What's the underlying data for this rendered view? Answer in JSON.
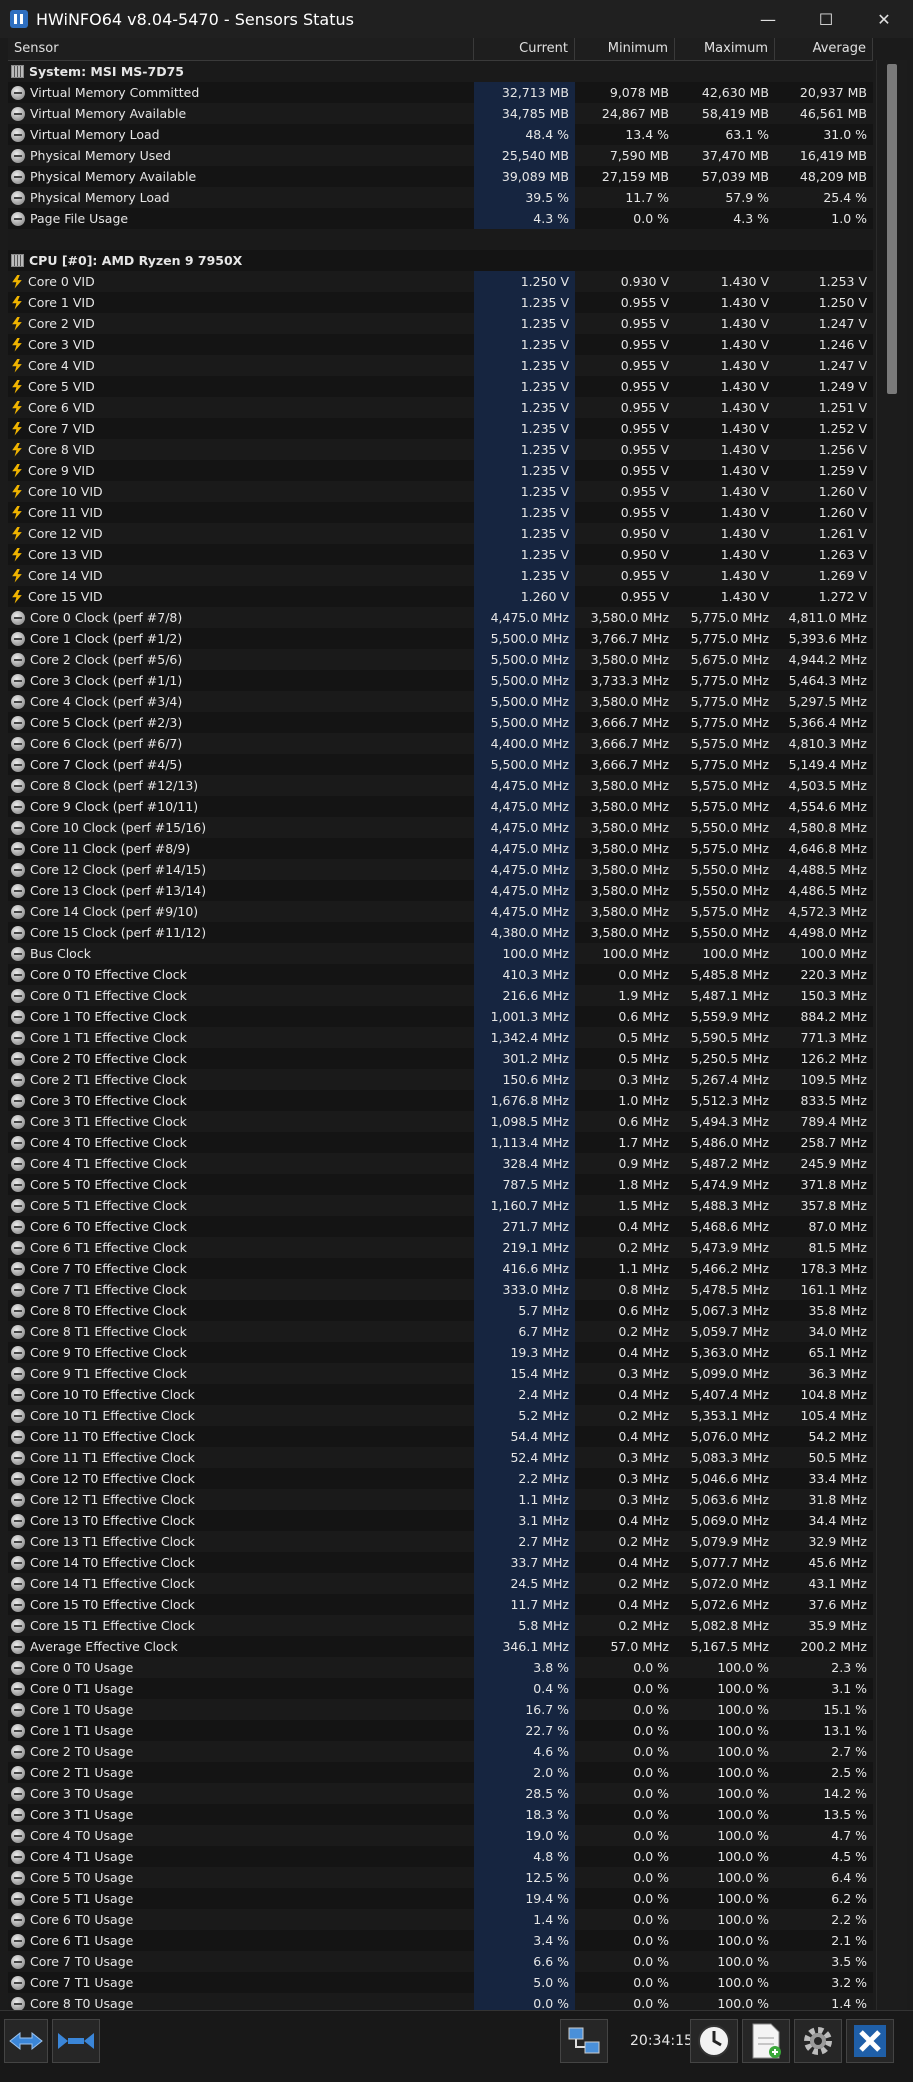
{
  "window": {
    "title": "HWiNFO64 v8.04-5470 - Sensors Status",
    "minimize": "—",
    "maximize": "☐",
    "close": "✕"
  },
  "columns": [
    "Sensor",
    "Current",
    "Minimum",
    "Maximum",
    "Average"
  ],
  "rows": [
    {
      "type": "group",
      "name": "System: MSI MS-7D75"
    },
    {
      "icon": "circle",
      "name": "Virtual Memory Committed",
      "cur": "32,713 MB",
      "min": "9,078 MB",
      "max": "42,630 MB",
      "avg": "20,937 MB"
    },
    {
      "icon": "circle",
      "name": "Virtual Memory Available",
      "cur": "34,785 MB",
      "min": "24,867 MB",
      "max": "58,419 MB",
      "avg": "46,561 MB"
    },
    {
      "icon": "circle",
      "name": "Virtual Memory Load",
      "cur": "48.4 %",
      "min": "13.4 %",
      "max": "63.1 %",
      "avg": "31.0 %"
    },
    {
      "icon": "circle",
      "name": "Physical Memory Used",
      "cur": "25,540 MB",
      "min": "7,590 MB",
      "max": "37,470 MB",
      "avg": "16,419 MB"
    },
    {
      "icon": "circle",
      "name": "Physical Memory Available",
      "cur": "39,089 MB",
      "min": "27,159 MB",
      "max": "57,039 MB",
      "avg": "48,209 MB"
    },
    {
      "icon": "circle",
      "name": "Physical Memory Load",
      "cur": "39.5 %",
      "min": "11.7 %",
      "max": "57.9 %",
      "avg": "25.4 %"
    },
    {
      "icon": "circle",
      "name": "Page File Usage",
      "cur": "4.3 %",
      "min": "0.0 %",
      "max": "4.3 %",
      "avg": "1.0 %"
    },
    {
      "type": "blank",
      "name": ""
    },
    {
      "type": "group",
      "name": "CPU [#0]: AMD Ryzen 9 7950X"
    },
    {
      "icon": "bolt",
      "name": "Core 0 VID",
      "cur": "1.250 V",
      "min": "0.930 V",
      "max": "1.430 V",
      "avg": "1.253 V"
    },
    {
      "icon": "bolt",
      "name": "Core 1 VID",
      "cur": "1.235 V",
      "min": "0.955 V",
      "max": "1.430 V",
      "avg": "1.250 V"
    },
    {
      "icon": "bolt",
      "name": "Core 2 VID",
      "cur": "1.235 V",
      "min": "0.955 V",
      "max": "1.430 V",
      "avg": "1.247 V"
    },
    {
      "icon": "bolt",
      "name": "Core 3 VID",
      "cur": "1.235 V",
      "min": "0.955 V",
      "max": "1.430 V",
      "avg": "1.246 V"
    },
    {
      "icon": "bolt",
      "name": "Core 4 VID",
      "cur": "1.235 V",
      "min": "0.955 V",
      "max": "1.430 V",
      "avg": "1.247 V"
    },
    {
      "icon": "bolt",
      "name": "Core 5 VID",
      "cur": "1.235 V",
      "min": "0.955 V",
      "max": "1.430 V",
      "avg": "1.249 V"
    },
    {
      "icon": "bolt",
      "name": "Core 6 VID",
      "cur": "1.235 V",
      "min": "0.955 V",
      "max": "1.430 V",
      "avg": "1.251 V"
    },
    {
      "icon": "bolt",
      "name": "Core 7 VID",
      "cur": "1.235 V",
      "min": "0.955 V",
      "max": "1.430 V",
      "avg": "1.252 V"
    },
    {
      "icon": "bolt",
      "name": "Core 8 VID",
      "cur": "1.235 V",
      "min": "0.955 V",
      "max": "1.430 V",
      "avg": "1.256 V"
    },
    {
      "icon": "bolt",
      "name": "Core 9 VID",
      "cur": "1.235 V",
      "min": "0.955 V",
      "max": "1.430 V",
      "avg": "1.259 V"
    },
    {
      "icon": "bolt",
      "name": "Core 10 VID",
      "cur": "1.235 V",
      "min": "0.955 V",
      "max": "1.430 V",
      "avg": "1.260 V"
    },
    {
      "icon": "bolt",
      "name": "Core 11 VID",
      "cur": "1.235 V",
      "min": "0.955 V",
      "max": "1.430 V",
      "avg": "1.260 V"
    },
    {
      "icon": "bolt",
      "name": "Core 12 VID",
      "cur": "1.235 V",
      "min": "0.950 V",
      "max": "1.430 V",
      "avg": "1.261 V"
    },
    {
      "icon": "bolt",
      "name": "Core 13 VID",
      "cur": "1.235 V",
      "min": "0.950 V",
      "max": "1.430 V",
      "avg": "1.263 V"
    },
    {
      "icon": "bolt",
      "name": "Core 14 VID",
      "cur": "1.235 V",
      "min": "0.955 V",
      "max": "1.430 V",
      "avg": "1.269 V"
    },
    {
      "icon": "bolt",
      "name": "Core 15 VID",
      "cur": "1.260 V",
      "min": "0.955 V",
      "max": "1.430 V",
      "avg": "1.272 V"
    },
    {
      "icon": "circle",
      "name": "Core 0 Clock (perf #7/8)",
      "cur": "4,475.0 MHz",
      "min": "3,580.0 MHz",
      "max": "5,775.0 MHz",
      "avg": "4,811.0 MHz"
    },
    {
      "icon": "circle",
      "name": "Core 1 Clock (perf #1/2)",
      "cur": "5,500.0 MHz",
      "min": "3,766.7 MHz",
      "max": "5,775.0 MHz",
      "avg": "5,393.6 MHz"
    },
    {
      "icon": "circle",
      "name": "Core 2 Clock (perf #5/6)",
      "cur": "5,500.0 MHz",
      "min": "3,580.0 MHz",
      "max": "5,675.0 MHz",
      "avg": "4,944.2 MHz"
    },
    {
      "icon": "circle",
      "name": "Core 3 Clock (perf #1/1)",
      "cur": "5,500.0 MHz",
      "min": "3,733.3 MHz",
      "max": "5,775.0 MHz",
      "avg": "5,464.3 MHz"
    },
    {
      "icon": "circle",
      "name": "Core 4 Clock (perf #3/4)",
      "cur": "5,500.0 MHz",
      "min": "3,580.0 MHz",
      "max": "5,775.0 MHz",
      "avg": "5,297.5 MHz"
    },
    {
      "icon": "circle",
      "name": "Core 5 Clock (perf #2/3)",
      "cur": "5,500.0 MHz",
      "min": "3,666.7 MHz",
      "max": "5,775.0 MHz",
      "avg": "5,366.4 MHz"
    },
    {
      "icon": "circle",
      "name": "Core 6 Clock (perf #6/7)",
      "cur": "4,400.0 MHz",
      "min": "3,666.7 MHz",
      "max": "5,575.0 MHz",
      "avg": "4,810.3 MHz"
    },
    {
      "icon": "circle",
      "name": "Core 7 Clock (perf #4/5)",
      "cur": "5,500.0 MHz",
      "min": "3,666.7 MHz",
      "max": "5,775.0 MHz",
      "avg": "5,149.4 MHz"
    },
    {
      "icon": "circle",
      "name": "Core 8 Clock (perf #12/13)",
      "cur": "4,475.0 MHz",
      "min": "3,580.0 MHz",
      "max": "5,575.0 MHz",
      "avg": "4,503.5 MHz"
    },
    {
      "icon": "circle",
      "name": "Core 9 Clock (perf #10/11)",
      "cur": "4,475.0 MHz",
      "min": "3,580.0 MHz",
      "max": "5,575.0 MHz",
      "avg": "4,554.6 MHz"
    },
    {
      "icon": "circle",
      "name": "Core 10 Clock (perf #15/16)",
      "cur": "4,475.0 MHz",
      "min": "3,580.0 MHz",
      "max": "5,550.0 MHz",
      "avg": "4,580.8 MHz"
    },
    {
      "icon": "circle",
      "name": "Core 11 Clock (perf #8/9)",
      "cur": "4,475.0 MHz",
      "min": "3,580.0 MHz",
      "max": "5,575.0 MHz",
      "avg": "4,646.8 MHz"
    },
    {
      "icon": "circle",
      "name": "Core 12 Clock (perf #14/15)",
      "cur": "4,475.0 MHz",
      "min": "3,580.0 MHz",
      "max": "5,550.0 MHz",
      "avg": "4,488.5 MHz"
    },
    {
      "icon": "circle",
      "name": "Core 13 Clock (perf #13/14)",
      "cur": "4,475.0 MHz",
      "min": "3,580.0 MHz",
      "max": "5,550.0 MHz",
      "avg": "4,486.5 MHz"
    },
    {
      "icon": "circle",
      "name": "Core 14 Clock (perf #9/10)",
      "cur": "4,475.0 MHz",
      "min": "3,580.0 MHz",
      "max": "5,575.0 MHz",
      "avg": "4,572.3 MHz"
    },
    {
      "icon": "circle",
      "name": "Core 15 Clock (perf #11/12)",
      "cur": "4,380.0 MHz",
      "min": "3,580.0 MHz",
      "max": "5,550.0 MHz",
      "avg": "4,498.0 MHz"
    },
    {
      "icon": "circle",
      "name": "Bus Clock",
      "cur": "100.0 MHz",
      "min": "100.0 MHz",
      "max": "100.0 MHz",
      "avg": "100.0 MHz"
    },
    {
      "icon": "circle",
      "name": "Core 0 T0 Effective Clock",
      "cur": "410.3 MHz",
      "min": "0.0 MHz",
      "max": "5,485.8 MHz",
      "avg": "220.3 MHz"
    },
    {
      "icon": "circle",
      "name": "Core 0 T1 Effective Clock",
      "cur": "216.6 MHz",
      "min": "1.9 MHz",
      "max": "5,487.1 MHz",
      "avg": "150.3 MHz"
    },
    {
      "icon": "circle",
      "name": "Core 1 T0 Effective Clock",
      "cur": "1,001.3 MHz",
      "min": "0.6 MHz",
      "max": "5,559.9 MHz",
      "avg": "884.2 MHz"
    },
    {
      "icon": "circle",
      "name": "Core 1 T1 Effective Clock",
      "cur": "1,342.4 MHz",
      "min": "0.5 MHz",
      "max": "5,590.5 MHz",
      "avg": "771.3 MHz"
    },
    {
      "icon": "circle",
      "name": "Core 2 T0 Effective Clock",
      "cur": "301.2 MHz",
      "min": "0.5 MHz",
      "max": "5,250.5 MHz",
      "avg": "126.2 MHz"
    },
    {
      "icon": "circle",
      "name": "Core 2 T1 Effective Clock",
      "cur": "150.6 MHz",
      "min": "0.3 MHz",
      "max": "5,267.4 MHz",
      "avg": "109.5 MHz"
    },
    {
      "icon": "circle",
      "name": "Core 3 T0 Effective Clock",
      "cur": "1,676.8 MHz",
      "min": "1.0 MHz",
      "max": "5,512.3 MHz",
      "avg": "833.5 MHz"
    },
    {
      "icon": "circle",
      "name": "Core 3 T1 Effective Clock",
      "cur": "1,098.5 MHz",
      "min": "0.6 MHz",
      "max": "5,494.3 MHz",
      "avg": "789.4 MHz"
    },
    {
      "icon": "circle",
      "name": "Core 4 T0 Effective Clock",
      "cur": "1,113.4 MHz",
      "min": "1.7 MHz",
      "max": "5,486.0 MHz",
      "avg": "258.7 MHz"
    },
    {
      "icon": "circle",
      "name": "Core 4 T1 Effective Clock",
      "cur": "328.4 MHz",
      "min": "0.9 MHz",
      "max": "5,487.2 MHz",
      "avg": "245.9 MHz"
    },
    {
      "icon": "circle",
      "name": "Core 5 T0 Effective Clock",
      "cur": "787.5 MHz",
      "min": "1.8 MHz",
      "max": "5,474.9 MHz",
      "avg": "371.8 MHz"
    },
    {
      "icon": "circle",
      "name": "Core 5 T1 Effective Clock",
      "cur": "1,160.7 MHz",
      "min": "1.5 MHz",
      "max": "5,488.3 MHz",
      "avg": "357.8 MHz"
    },
    {
      "icon": "circle",
      "name": "Core 6 T0 Effective Clock",
      "cur": "271.7 MHz",
      "min": "0.4 MHz",
      "max": "5,468.6 MHz",
      "avg": "87.0 MHz"
    },
    {
      "icon": "circle",
      "name": "Core 6 T1 Effective Clock",
      "cur": "219.1 MHz",
      "min": "0.2 MHz",
      "max": "5,473.9 MHz",
      "avg": "81.5 MHz"
    },
    {
      "icon": "circle",
      "name": "Core 7 T0 Effective Clock",
      "cur": "416.6 MHz",
      "min": "1.1 MHz",
      "max": "5,466.2 MHz",
      "avg": "178.3 MHz"
    },
    {
      "icon": "circle",
      "name": "Core 7 T1 Effective Clock",
      "cur": "333.0 MHz",
      "min": "0.8 MHz",
      "max": "5,478.5 MHz",
      "avg": "161.1 MHz"
    },
    {
      "icon": "circle",
      "name": "Core 8 T0 Effective Clock",
      "cur": "5.7 MHz",
      "min": "0.6 MHz",
      "max": "5,067.3 MHz",
      "avg": "35.8 MHz"
    },
    {
      "icon": "circle",
      "name": "Core 8 T1 Effective Clock",
      "cur": "6.7 MHz",
      "min": "0.2 MHz",
      "max": "5,059.7 MHz",
      "avg": "34.0 MHz"
    },
    {
      "icon": "circle",
      "name": "Core 9 T0 Effective Clock",
      "cur": "19.3 MHz",
      "min": "0.4 MHz",
      "max": "5,363.0 MHz",
      "avg": "65.1 MHz"
    },
    {
      "icon": "circle",
      "name": "Core 9 T1 Effective Clock",
      "cur": "15.4 MHz",
      "min": "0.3 MHz",
      "max": "5,099.0 MHz",
      "avg": "36.3 MHz"
    },
    {
      "icon": "circle",
      "name": "Core 10 T0 Effective Clock",
      "cur": "2.4 MHz",
      "min": "0.4 MHz",
      "max": "5,407.4 MHz",
      "avg": "104.8 MHz"
    },
    {
      "icon": "circle",
      "name": "Core 10 T1 Effective Clock",
      "cur": "5.2 MHz",
      "min": "0.2 MHz",
      "max": "5,353.1 MHz",
      "avg": "105.4 MHz"
    },
    {
      "icon": "circle",
      "name": "Core 11 T0 Effective Clock",
      "cur": "54.4 MHz",
      "min": "0.4 MHz",
      "max": "5,076.0 MHz",
      "avg": "54.2 MHz"
    },
    {
      "icon": "circle",
      "name": "Core 11 T1 Effective Clock",
      "cur": "52.4 MHz",
      "min": "0.3 MHz",
      "max": "5,083.3 MHz",
      "avg": "50.5 MHz"
    },
    {
      "icon": "circle",
      "name": "Core 12 T0 Effective Clock",
      "cur": "2.2 MHz",
      "min": "0.3 MHz",
      "max": "5,046.6 MHz",
      "avg": "33.4 MHz"
    },
    {
      "icon": "circle",
      "name": "Core 12 T1 Effective Clock",
      "cur": "1.1 MHz",
      "min": "0.3 MHz",
      "max": "5,063.6 MHz",
      "avg": "31.8 MHz"
    },
    {
      "icon": "circle",
      "name": "Core 13 T0 Effective Clock",
      "cur": "3.1 MHz",
      "min": "0.4 MHz",
      "max": "5,069.0 MHz",
      "avg": "34.4 MHz"
    },
    {
      "icon": "circle",
      "name": "Core 13 T1 Effective Clock",
      "cur": "2.7 MHz",
      "min": "0.2 MHz",
      "max": "5,079.9 MHz",
      "avg": "32.9 MHz"
    },
    {
      "icon": "circle",
      "name": "Core 14 T0 Effective Clock",
      "cur": "33.7 MHz",
      "min": "0.4 MHz",
      "max": "5,077.7 MHz",
      "avg": "45.6 MHz"
    },
    {
      "icon": "circle",
      "name": "Core 14 T1 Effective Clock",
      "cur": "24.5 MHz",
      "min": "0.2 MHz",
      "max": "5,072.0 MHz",
      "avg": "43.1 MHz"
    },
    {
      "icon": "circle",
      "name": "Core 15 T0 Effective Clock",
      "cur": "11.7 MHz",
      "min": "0.4 MHz",
      "max": "5,072.6 MHz",
      "avg": "37.6 MHz"
    },
    {
      "icon": "circle",
      "name": "Core 15 T1 Effective Clock",
      "cur": "5.8 MHz",
      "min": "0.2 MHz",
      "max": "5,082.8 MHz",
      "avg": "35.9 MHz"
    },
    {
      "icon": "circle",
      "name": "Average Effective Clock",
      "cur": "346.1 MHz",
      "min": "57.0 MHz",
      "max": "5,167.5 MHz",
      "avg": "200.2 MHz"
    },
    {
      "icon": "circle",
      "name": "Core 0 T0 Usage",
      "cur": "3.8 %",
      "min": "0.0 %",
      "max": "100.0 %",
      "avg": "2.3 %"
    },
    {
      "icon": "circle",
      "name": "Core 0 T1 Usage",
      "cur": "0.4 %",
      "min": "0.0 %",
      "max": "100.0 %",
      "avg": "3.1 %"
    },
    {
      "icon": "circle",
      "name": "Core 1 T0 Usage",
      "cur": "16.7 %",
      "min": "0.0 %",
      "max": "100.0 %",
      "avg": "15.1 %"
    },
    {
      "icon": "circle",
      "name": "Core 1 T1 Usage",
      "cur": "22.7 %",
      "min": "0.0 %",
      "max": "100.0 %",
      "avg": "13.1 %"
    },
    {
      "icon": "circle",
      "name": "Core 2 T0 Usage",
      "cur": "4.6 %",
      "min": "0.0 %",
      "max": "100.0 %",
      "avg": "2.7 %"
    },
    {
      "icon": "circle",
      "name": "Core 2 T1 Usage",
      "cur": "2.0 %",
      "min": "0.0 %",
      "max": "100.0 %",
      "avg": "2.5 %"
    },
    {
      "icon": "circle",
      "name": "Core 3 T0 Usage",
      "cur": "28.5 %",
      "min": "0.0 %",
      "max": "100.0 %",
      "avg": "14.2 %"
    },
    {
      "icon": "circle",
      "name": "Core 3 T1 Usage",
      "cur": "18.3 %",
      "min": "0.0 %",
      "max": "100.0 %",
      "avg": "13.5 %"
    },
    {
      "icon": "circle",
      "name": "Core 4 T0 Usage",
      "cur": "19.0 %",
      "min": "0.0 %",
      "max": "100.0 %",
      "avg": "4.7 %"
    },
    {
      "icon": "circle",
      "name": "Core 4 T1 Usage",
      "cur": "4.8 %",
      "min": "0.0 %",
      "max": "100.0 %",
      "avg": "4.5 %"
    },
    {
      "icon": "circle",
      "name": "Core 5 T0 Usage",
      "cur": "12.5 %",
      "min": "0.0 %",
      "max": "100.0 %",
      "avg": "6.4 %"
    },
    {
      "icon": "circle",
      "name": "Core 5 T1 Usage",
      "cur": "19.4 %",
      "min": "0.0 %",
      "max": "100.0 %",
      "avg": "6.2 %"
    },
    {
      "icon": "circle",
      "name": "Core 6 T0 Usage",
      "cur": "1.4 %",
      "min": "0.0 %",
      "max": "100.0 %",
      "avg": "2.2 %"
    },
    {
      "icon": "circle",
      "name": "Core 6 T1 Usage",
      "cur": "3.4 %",
      "min": "0.0 %",
      "max": "100.0 %",
      "avg": "2.1 %"
    },
    {
      "icon": "circle",
      "name": "Core 7 T0 Usage",
      "cur": "6.6 %",
      "min": "0.0 %",
      "max": "100.0 %",
      "avg": "3.5 %"
    },
    {
      "icon": "circle",
      "name": "Core 7 T1 Usage",
      "cur": "5.0 %",
      "min": "0.0 %",
      "max": "100.0 %",
      "avg": "3.2 %"
    },
    {
      "icon": "circle",
      "name": "Core 8 T0 Usage",
      "cur": "0.0 %",
      "min": "0.0 %",
      "max": "100.0 %",
      "avg": "1.4 %"
    }
  ],
  "footer": {
    "time": "20:34:15",
    "icons": [
      "expand-arrows-icon",
      "collapse-arrows-icon",
      "network-icon",
      "clock-icon",
      "report-icon",
      "settings-gear-icon",
      "close-x-icon"
    ]
  }
}
